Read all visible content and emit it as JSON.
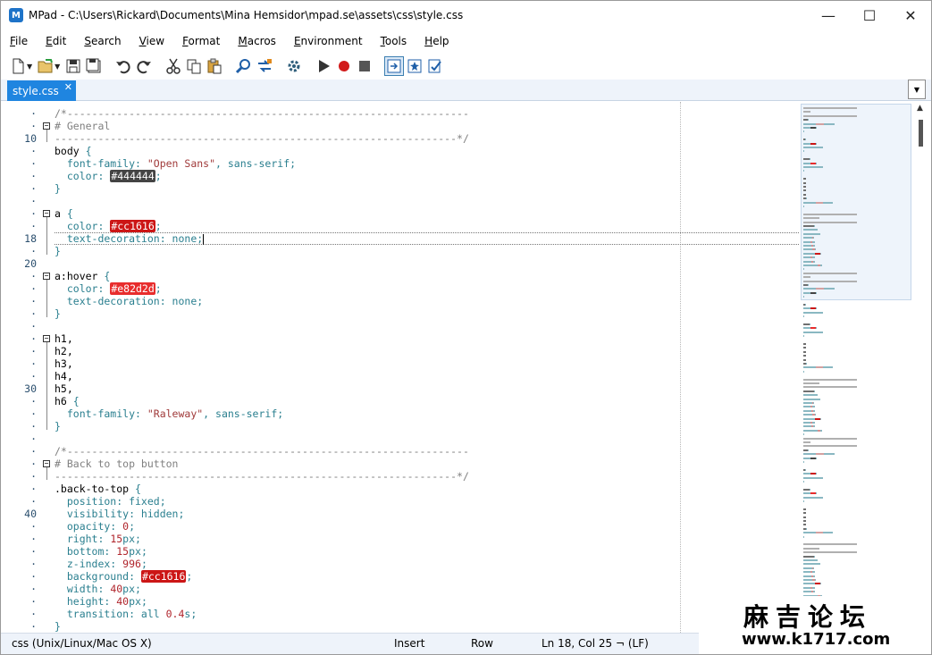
{
  "window": {
    "title": "MPad - C:\\Users\\Rickard\\Documents\\Mina Hemsidor\\mpad.se\\assets\\css\\style.css",
    "app_badge": "M",
    "minimize": "—",
    "maximize": "☐",
    "close": "✕"
  },
  "menu": [
    {
      "label": "File",
      "u": "F",
      "rest": "ile"
    },
    {
      "label": "Edit",
      "u": "E",
      "rest": "dit"
    },
    {
      "label": "Search",
      "u": "S",
      "rest": "earch"
    },
    {
      "label": "View",
      "u": "V",
      "rest": "iew"
    },
    {
      "label": "Format",
      "u": "F",
      "rest": "ormat"
    },
    {
      "label": "Macros",
      "u": "M",
      "rest": "acros"
    },
    {
      "label": "Environment",
      "u": "E",
      "rest": "nvironment"
    },
    {
      "label": "Tools",
      "u": "T",
      "rest": "ools"
    },
    {
      "label": "Help",
      "u": "H",
      "rest": "elp"
    }
  ],
  "toolbar": {
    "icons": [
      "new-file-icon",
      "open-folder-icon",
      "save-icon",
      "save-all-icon",
      "undo-icon",
      "redo-icon",
      "cut-icon",
      "copy-icon",
      "paste-icon",
      "find-icon",
      "replace-icon",
      "settings-icon",
      "play-macro-icon",
      "record-macro-icon",
      "stop-macro-icon",
      "toggle-panel-icon",
      "bookmark-icon",
      "spellcheck-icon"
    ]
  },
  "tabs": [
    {
      "label": "style.css",
      "close": "✕",
      "active": true
    }
  ],
  "tab_menu": "▼",
  "editor": {
    "line_numbers": [
      {
        "row": 0,
        "text": "·"
      },
      {
        "row": 1,
        "text": "·"
      },
      {
        "row": 2,
        "text": "10"
      },
      {
        "row": 3,
        "text": "·"
      },
      {
        "row": 4,
        "text": "·"
      },
      {
        "row": 5,
        "text": "·"
      },
      {
        "row": 6,
        "text": "·"
      },
      {
        "row": 7,
        "text": "·"
      },
      {
        "row": 8,
        "text": "·"
      },
      {
        "row": 9,
        "text": "·"
      },
      {
        "row": 10,
        "text": "18"
      },
      {
        "row": 11,
        "text": "·"
      },
      {
        "row": 12,
        "text": "20"
      },
      {
        "row": 13,
        "text": "·"
      },
      {
        "row": 14,
        "text": "·"
      },
      {
        "row": 15,
        "text": "·"
      },
      {
        "row": 16,
        "text": "·"
      },
      {
        "row": 17,
        "text": "·"
      },
      {
        "row": 18,
        "text": "·"
      },
      {
        "row": 19,
        "text": "·"
      },
      {
        "row": 20,
        "text": "·"
      },
      {
        "row": 21,
        "text": "·"
      },
      {
        "row": 22,
        "text": "30"
      },
      {
        "row": 23,
        "text": "·"
      },
      {
        "row": 24,
        "text": "·"
      },
      {
        "row": 25,
        "text": "·"
      },
      {
        "row": 26,
        "text": "·"
      },
      {
        "row": 27,
        "text": "·"
      },
      {
        "row": 28,
        "text": "·"
      },
      {
        "row": 29,
        "text": "·"
      },
      {
        "row": 30,
        "text": "·"
      },
      {
        "row": 31,
        "text": "·"
      },
      {
        "row": 32,
        "text": "40"
      },
      {
        "row": 33,
        "text": "·"
      },
      {
        "row": 34,
        "text": "·"
      },
      {
        "row": 35,
        "text": "·"
      },
      {
        "row": 36,
        "text": "·"
      },
      {
        "row": 37,
        "text": "·"
      },
      {
        "row": 38,
        "text": "·"
      },
      {
        "row": 39,
        "text": "·"
      },
      {
        "row": 40,
        "text": "·"
      },
      {
        "row": 41,
        "text": "·"
      },
      {
        "row": 42,
        "text": "·"
      }
    ],
    "lines": [
      [
        {
          "t": "/*-----------------------------------------------------------------",
          "c": "cm"
        }
      ],
      [
        {
          "t": "# General",
          "c": "cm"
        }
      ],
      [
        {
          "t": "-----------------------------------------------------------------*/",
          "c": "cm"
        }
      ],
      [
        {
          "t": "body ",
          "c": "sel"
        },
        {
          "t": "{",
          "c": "pn"
        }
      ],
      [
        {
          "t": "  font-family: ",
          "c": "kw"
        },
        {
          "t": "\"Open Sans\"",
          "c": "str"
        },
        {
          "t": ", sans-serif;",
          "c": "kw"
        }
      ],
      [
        {
          "t": "  color: ",
          "c": "kw"
        },
        {
          "t": "#444444",
          "c": "sw",
          "bg": "#444444"
        },
        {
          "t": ";",
          "c": "kw"
        }
      ],
      [
        {
          "t": "}",
          "c": "pn"
        }
      ],
      [
        {
          "t": "",
          "c": "sel"
        }
      ],
      [
        {
          "t": "a ",
          "c": "sel"
        },
        {
          "t": "{",
          "c": "pn"
        }
      ],
      [
        {
          "t": "  color: ",
          "c": "kw"
        },
        {
          "t": "#cc1616",
          "c": "sw",
          "bg": "#cc1616"
        },
        {
          "t": ";",
          "c": "kw"
        }
      ],
      [
        {
          "t": "  text-decoration: none;",
          "c": "kw"
        },
        {
          "t": "",
          "c": "caret"
        }
      ],
      [
        {
          "t": "}",
          "c": "pn"
        }
      ],
      [
        {
          "t": "",
          "c": "sel"
        }
      ],
      [
        {
          "t": "a:hover ",
          "c": "sel"
        },
        {
          "t": "{",
          "c": "pn"
        }
      ],
      [
        {
          "t": "  color: ",
          "c": "kw"
        },
        {
          "t": "#e82d2d",
          "c": "sw",
          "bg": "#e82d2d"
        },
        {
          "t": ";",
          "c": "kw"
        }
      ],
      [
        {
          "t": "  text-decoration: none;",
          "c": "kw"
        }
      ],
      [
        {
          "t": "}",
          "c": "pn"
        }
      ],
      [
        {
          "t": "",
          "c": "sel"
        }
      ],
      [
        {
          "t": "h1,",
          "c": "sel"
        }
      ],
      [
        {
          "t": "h2,",
          "c": "sel"
        }
      ],
      [
        {
          "t": "h3,",
          "c": "sel"
        }
      ],
      [
        {
          "t": "h4,",
          "c": "sel"
        }
      ],
      [
        {
          "t": "h5,",
          "c": "sel"
        }
      ],
      [
        {
          "t": "h6 ",
          "c": "sel"
        },
        {
          "t": "{",
          "c": "pn"
        }
      ],
      [
        {
          "t": "  font-family: ",
          "c": "kw"
        },
        {
          "t": "\"Raleway\"",
          "c": "str"
        },
        {
          "t": ", sans-serif;",
          "c": "kw"
        }
      ],
      [
        {
          "t": "}",
          "c": "pn"
        }
      ],
      [
        {
          "t": "",
          "c": "sel"
        }
      ],
      [
        {
          "t": "/*-----------------------------------------------------------------",
          "c": "cm"
        }
      ],
      [
        {
          "t": "# Back to top button",
          "c": "cm"
        }
      ],
      [
        {
          "t": "-----------------------------------------------------------------*/",
          "c": "cm"
        }
      ],
      [
        {
          "t": ".back-to-top ",
          "c": "sel"
        },
        {
          "t": "{",
          "c": "pn"
        }
      ],
      [
        {
          "t": "  position: fixed;",
          "c": "kw"
        }
      ],
      [
        {
          "t": "  visibility: hidden;",
          "c": "kw"
        }
      ],
      [
        {
          "t": "  opacity: ",
          "c": "kw"
        },
        {
          "t": "0",
          "c": "num"
        },
        {
          "t": ";",
          "c": "kw"
        }
      ],
      [
        {
          "t": "  right: ",
          "c": "kw"
        },
        {
          "t": "15",
          "c": "num"
        },
        {
          "t": "px;",
          "c": "kw"
        }
      ],
      [
        {
          "t": "  bottom: ",
          "c": "kw"
        },
        {
          "t": "15",
          "c": "num"
        },
        {
          "t": "px;",
          "c": "kw"
        }
      ],
      [
        {
          "t": "  z-index: ",
          "c": "kw"
        },
        {
          "t": "996",
          "c": "num"
        },
        {
          "t": ";",
          "c": "kw"
        }
      ],
      [
        {
          "t": "  background: ",
          "c": "kw"
        },
        {
          "t": "#cc1616",
          "c": "sw",
          "bg": "#cc1616"
        },
        {
          "t": ";",
          "c": "kw"
        }
      ],
      [
        {
          "t": "  width: ",
          "c": "kw"
        },
        {
          "t": "40",
          "c": "num"
        },
        {
          "t": "px;",
          "c": "kw"
        }
      ],
      [
        {
          "t": "  height: ",
          "c": "kw"
        },
        {
          "t": "40",
          "c": "num"
        },
        {
          "t": "px;",
          "c": "kw"
        }
      ],
      [
        {
          "t": "  transition: all ",
          "c": "kw"
        },
        {
          "t": "0.4",
          "c": "num"
        },
        {
          "t": "s;",
          "c": "kw"
        }
      ],
      [
        {
          "t": "}",
          "c": "pn"
        }
      ]
    ],
    "fold_markers": [
      {
        "row": 1,
        "sym": "−"
      },
      {
        "row": 8,
        "sym": "−"
      },
      {
        "row": 13,
        "sym": "−"
      },
      {
        "row": 18,
        "sym": "−"
      },
      {
        "row": 28,
        "sym": "−"
      }
    ],
    "current_line_row": 10
  },
  "status": {
    "syntax": "css (Unix/Linux/Mac OS X)",
    "mode": "Insert",
    "selection": "Row",
    "position": "Ln 18, Col 25 ¬ (LF)"
  },
  "watermark": {
    "cn": "麻吉论坛",
    "url": "www.k1717.com"
  },
  "colors": {
    "tab_active": "#1f85e0",
    "accent": "#cc1616"
  }
}
